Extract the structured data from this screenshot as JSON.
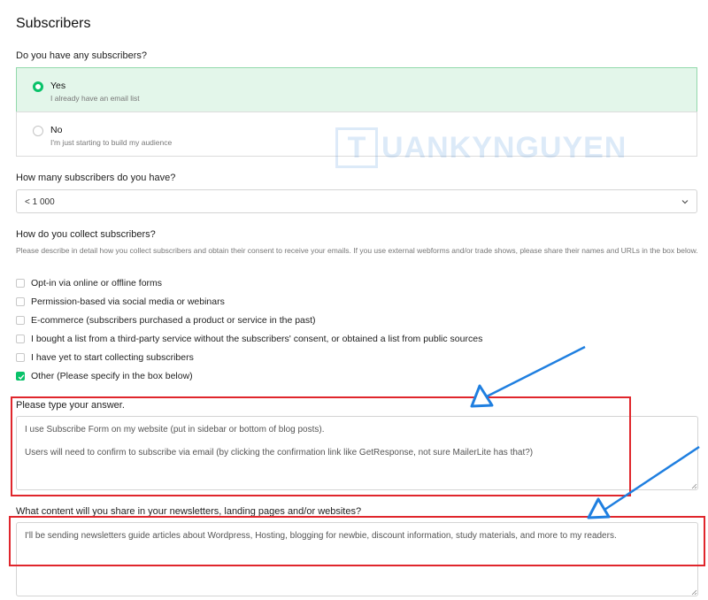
{
  "page_title": "Subscribers",
  "q_have_subscribers": {
    "label": "Do you have any subscribers?",
    "options": [
      {
        "title": "Yes",
        "subtitle": "I already have an email list",
        "selected": true
      },
      {
        "title": "No",
        "subtitle": "I'm just starting to build my audience",
        "selected": false
      }
    ]
  },
  "q_how_many": {
    "label": "How many subscribers do you have?",
    "value": "< 1 000"
  },
  "q_collect": {
    "label": "How do you collect subscribers?",
    "description": "Please describe in detail how you collect subscribers and obtain their consent to receive your emails. If you use external webforms and/or trade shows, please share their names and URLs in the box below.",
    "options": [
      {
        "label": "Opt-in via online or offline forms",
        "checked": false
      },
      {
        "label": "Permission-based via social media or webinars",
        "checked": false
      },
      {
        "label": "E-commerce (subscribers purchased a product or service in the past)",
        "checked": false
      },
      {
        "label": "I bought a list from a third-party service without the subscribers' consent, or obtained a list from public sources",
        "checked": false
      },
      {
        "label": "I have yet to start collecting subscribers",
        "checked": false
      },
      {
        "label": "Other (Please specify in the box below)",
        "checked": true
      }
    ]
  },
  "q_answer": {
    "label": "Please type your answer.",
    "value": "I use Subscribe Form on my website (put in sidebar or bottom of blog posts).\n\nUsers will need to confirm to subscribe via email (by clicking the confirmation link like GetResponse, not sure MailerLite has that?)"
  },
  "q_content": {
    "label": "What content will you share in your newsletters, landing pages and/or websites?",
    "value": "I'll be sending newsletters guide articles about Wordpress, Hosting, blogging for newbie, discount information, study materials, and more to my readers."
  },
  "watermark": {
    "letter": "T",
    "text": "UANKYNGUYEN"
  },
  "colors": {
    "accent": "#09c269",
    "selected_bg": "#e3f6ea",
    "annotation_red": "#e0262c",
    "annotation_arrow": "#1f7fe0"
  }
}
